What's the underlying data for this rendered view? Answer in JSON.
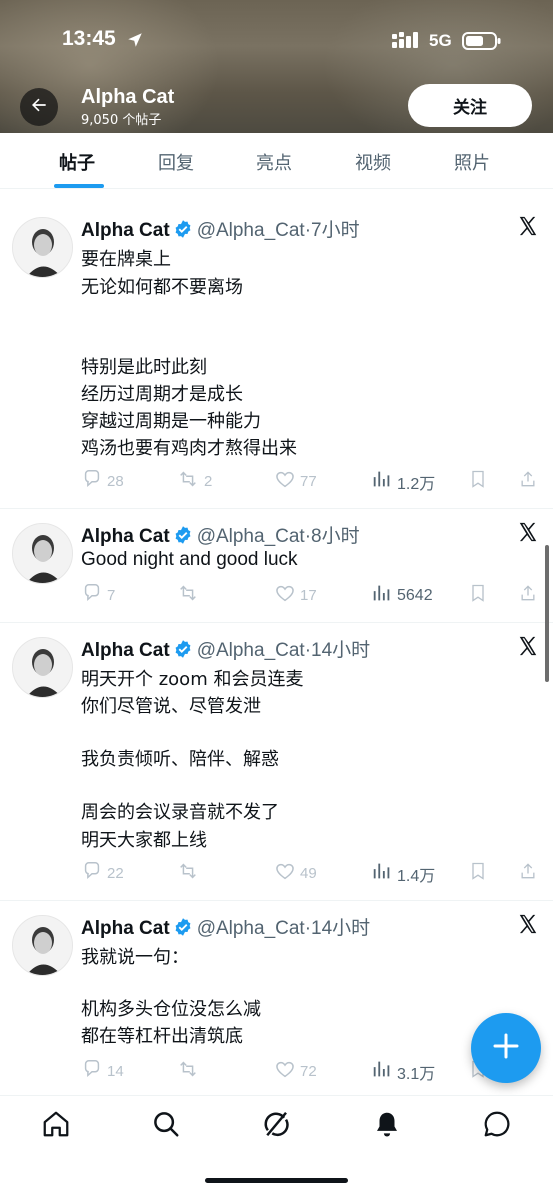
{
  "status_bar": {
    "time": "13:45",
    "network": "5G"
  },
  "profile": {
    "name": "Alpha Cat",
    "post_count": "9,050 个帖子",
    "follow_label": "关注"
  },
  "tabs": [
    {
      "label": "帖子",
      "active": true
    },
    {
      "label": "回复",
      "active": false
    },
    {
      "label": "亮点",
      "active": false
    },
    {
      "label": "视频",
      "active": false
    },
    {
      "label": "照片",
      "active": false
    }
  ],
  "tweets": [
    {
      "author": "Alpha Cat",
      "handle": "@Alpha_Cat",
      "time": "·7小时",
      "lines": [
        "要在牌桌上",
        "无论如何都不要离场",
        "",
        "特别是此时此刻",
        "经历过周期才是成长",
        "穿越过周期是一种能力",
        "",
        "鸡汤也要有鸡肉才熬得出来"
      ],
      "replies": "28",
      "retweets": "2",
      "likes": "77",
      "views": "1.2万"
    },
    {
      "author": "Alpha Cat",
      "handle": "@Alpha_Cat",
      "time": "·8小时",
      "lines": [
        "Good night and good luck"
      ],
      "replies": "7",
      "retweets": "",
      "likes": "17",
      "views": "5642"
    },
    {
      "author": "Alpha Cat",
      "handle": "@Alpha_Cat",
      "time": "·14小时",
      "lines": [
        "明天开个 zoom 和会员连麦",
        "你们尽管说、尽管发泄",
        "",
        "我负责倾听、陪伴、解惑",
        "",
        "周会的会议录音就不发了",
        "明天大家都上线"
      ],
      "replies": "22",
      "retweets": "",
      "likes": "49",
      "views": "1.4万"
    },
    {
      "author": "Alpha Cat",
      "handle": "@Alpha_Cat",
      "time": "·14小时",
      "lines": [
        "我就说一句：",
        "",
        "机构多头仓位没怎么减",
        "都在等杠杆出清筑底"
      ],
      "replies": "14",
      "retweets": "",
      "likes": "72",
      "views": "3.1万"
    }
  ],
  "colors": {
    "accent": "#1d9bf0",
    "text": "#0f1419",
    "muted": "#536471",
    "divider": "#eff3f4"
  },
  "icons": {
    "bottom_nav": [
      "home-icon",
      "search-icon",
      "grok-icon",
      "notifications-icon",
      "messages-icon"
    ],
    "tweet_actions": [
      "reply-icon",
      "retweet-icon",
      "like-icon",
      "views-icon",
      "bookmark-icon",
      "share-icon"
    ]
  }
}
